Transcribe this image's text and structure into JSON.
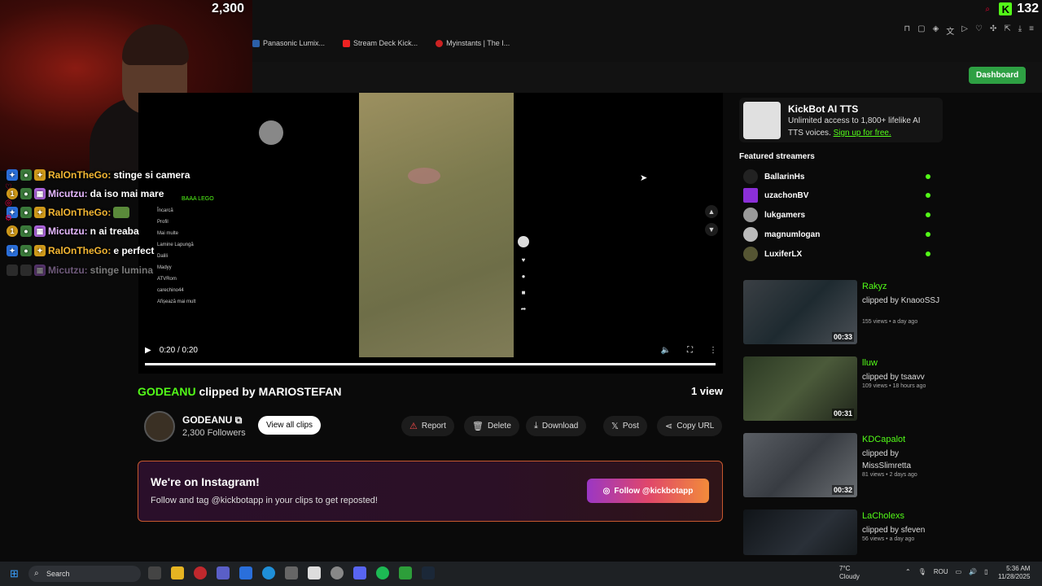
{
  "stream": {
    "viewer_count": "2,300",
    "kick_count": "132"
  },
  "bookmarks": [
    "Panasonic Lumix...",
    "Stream Deck Kick...",
    "Myinstants | The I..."
  ],
  "dashboard_label": "Dashboard",
  "chat": [
    {
      "user": "RalOnTheGo:",
      "msg": "stinge si camera",
      "badge": "4"
    },
    {
      "user": "Micutzu:",
      "msg": "da iso mai mare",
      "badge": "1"
    },
    {
      "user": "RalOnTheGo:",
      "msg": "",
      "badge": ""
    },
    {
      "user": "Micutzu:",
      "msg": "n ai treaba",
      "badge": "1"
    },
    {
      "user": "RalOnTheGo:",
      "msg": "e perfect",
      "badge": ""
    },
    {
      "user": "Micutzu:",
      "msg": "stinge lumina",
      "badge": ""
    }
  ],
  "tiktok_panel": [
    "Încarcă",
    "Profil",
    "Mai multe",
    "Lamine Lapungă",
    "Dalili",
    "Madyy",
    "ATVRom",
    "carechino44",
    "Afișează mai mult"
  ],
  "tiktok_overlay_text": "BAAA LEGO",
  "player": {
    "time": "0:20 / 0:20"
  },
  "clip": {
    "streamer": "GODEANU",
    "clipped_by_text": "clipped by MARIOSTEFAN",
    "views": "1 view",
    "channel_name": "GODEANU",
    "followers": "2,300 Followers",
    "view_all_label": "View all clips"
  },
  "actions": {
    "report": "Report",
    "delete": "Delete",
    "download": "Download",
    "post": "Post",
    "copy_url": "Copy URL"
  },
  "instagram": {
    "title": "We're on Instagram!",
    "subtitle": "Follow and tag @kickbotapp in your clips to get reposted!",
    "button": "Follow @kickbotapp"
  },
  "tts": {
    "title": "KickBot AI TTS",
    "text": "Unlimited access to 1,800+ lifelike AI TTS voices.",
    "link": "Sign up for free."
  },
  "featured": {
    "heading": "Featured streamers",
    "items": [
      "BallarinHs",
      "uzachonBV",
      "lukgamers",
      "magnumlogan",
      "LuxiferLX"
    ]
  },
  "related_clips": [
    {
      "name": "Rakyz",
      "by": "clipped by KnaooSSJ",
      "meta": "155 views • a day ago",
      "duration": "00:33"
    },
    {
      "name": "lluw",
      "by": "clipped by tsaavv",
      "meta": "109 views • 18 hours ago",
      "duration": "00:31"
    },
    {
      "name": "KDCapalot",
      "by": "clipped by MissSlimretta",
      "meta": "81 views • 2 days ago",
      "duration": "00:32"
    },
    {
      "name": "LaCholexs",
      "by": "clipped by sfeven",
      "meta": "56 views • a day ago",
      "duration": ""
    }
  ],
  "taskbar": {
    "search": "Search",
    "temp": "7°C",
    "weather": "Cloudy",
    "lang": "ROU",
    "time": "5:36 AM",
    "date": "11/28/2025"
  },
  "colors": {
    "kick_green": "#53fc18",
    "report_red": "#ff4b4b"
  }
}
